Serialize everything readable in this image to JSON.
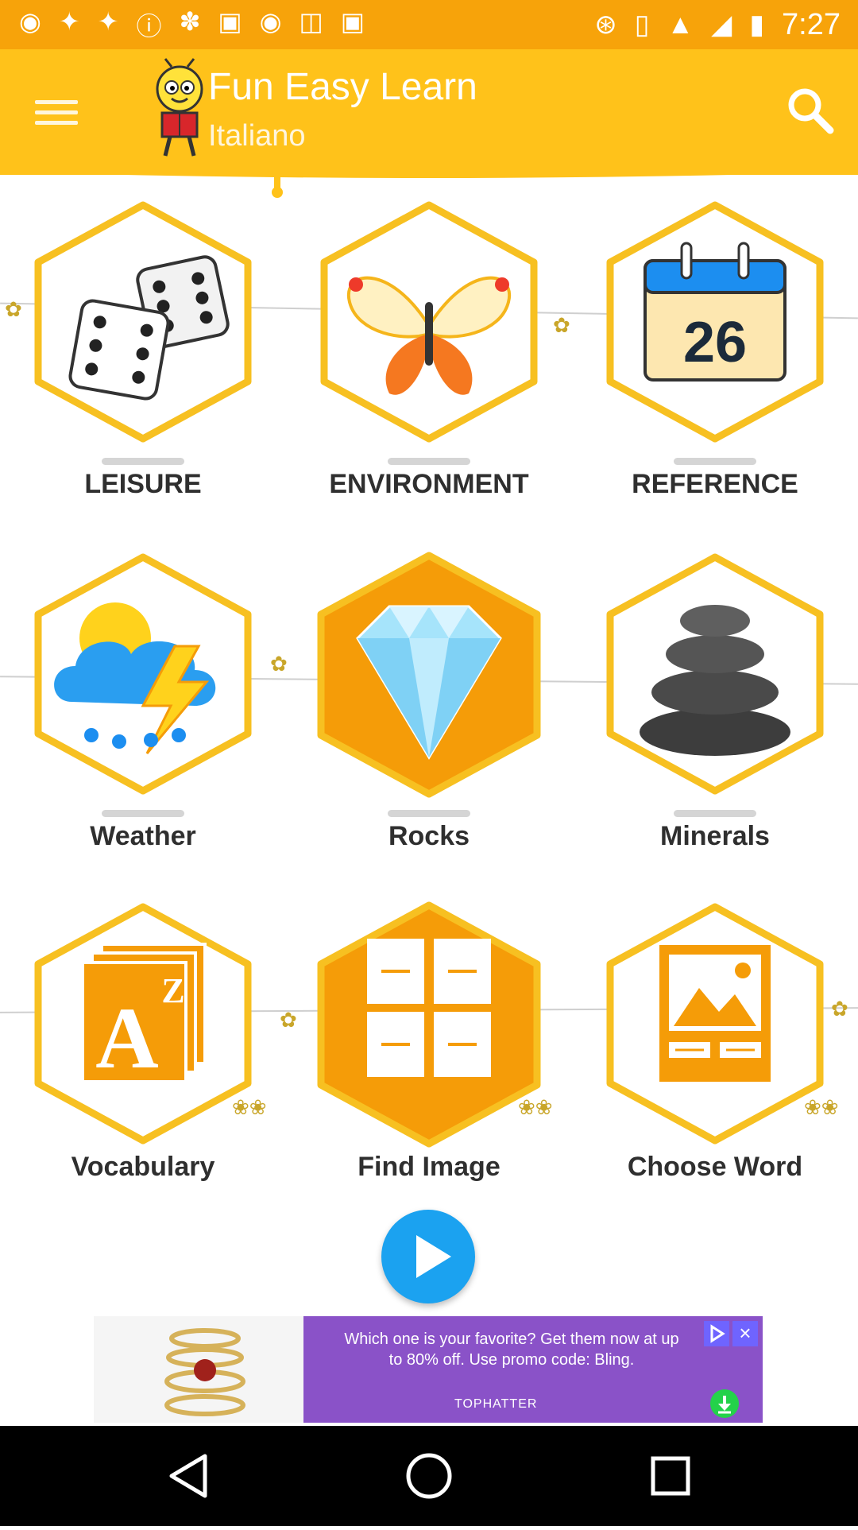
{
  "status_bar": {
    "time": "7:27",
    "icons": [
      "radio-icon",
      "puzzle-icon",
      "puzzle-icon",
      "alert-icon",
      "satellite-icon",
      "lock-icon",
      "cat-icon",
      "inbox-icon",
      "briefcase-icon"
    ],
    "right_icons": [
      "bluetooth-icon",
      "vibrate-icon",
      "wifi-icon",
      "signal-icon",
      "battery-icon"
    ]
  },
  "header": {
    "title": "Fun Easy Learn",
    "subtitle": "Italiano",
    "menu_icon": "hamburger-menu-icon",
    "search_icon": "search-icon"
  },
  "categories": [
    {
      "label": "LEISURE",
      "icon": "dice-icon"
    },
    {
      "label": "ENVIRONMENT",
      "icon": "butterfly-icon"
    },
    {
      "label": "REFERENCE",
      "icon": "calendar-icon",
      "calendar_day": "26"
    },
    {
      "label": "Weather",
      "icon": "storm-cloud-icon"
    },
    {
      "label": "Rocks",
      "icon": "diamond-icon"
    },
    {
      "label": "Minerals",
      "icon": "stacked-stones-icon"
    },
    {
      "label": "Vocabulary",
      "icon": "alphabet-cards-icon",
      "letter_big": "A",
      "letter_small": "Z"
    },
    {
      "label": "Find Image",
      "icon": "image-grid-icon"
    },
    {
      "label": "Choose Word",
      "icon": "picture-word-icon"
    }
  ],
  "play_button": {
    "icon": "play-icon"
  },
  "ad": {
    "text": "Which one is your favorite? Get them now at up to 80% off. Use promo code: Bling.",
    "brand": "TOPHATTER",
    "close_icon": "close-icon",
    "choices_icon": "ad-choices-icon",
    "download_icon": "download-icon"
  },
  "colors": {
    "status_bar": "#f7a30a",
    "app_bar": "#ffc21a",
    "hex_border": "#f7c021",
    "hex_fill_active": "#f59c08",
    "play_button": "#1ba2f0",
    "ad_background": "#8a52c8"
  },
  "navigation": [
    "back-icon",
    "home-icon",
    "recents-icon"
  ]
}
